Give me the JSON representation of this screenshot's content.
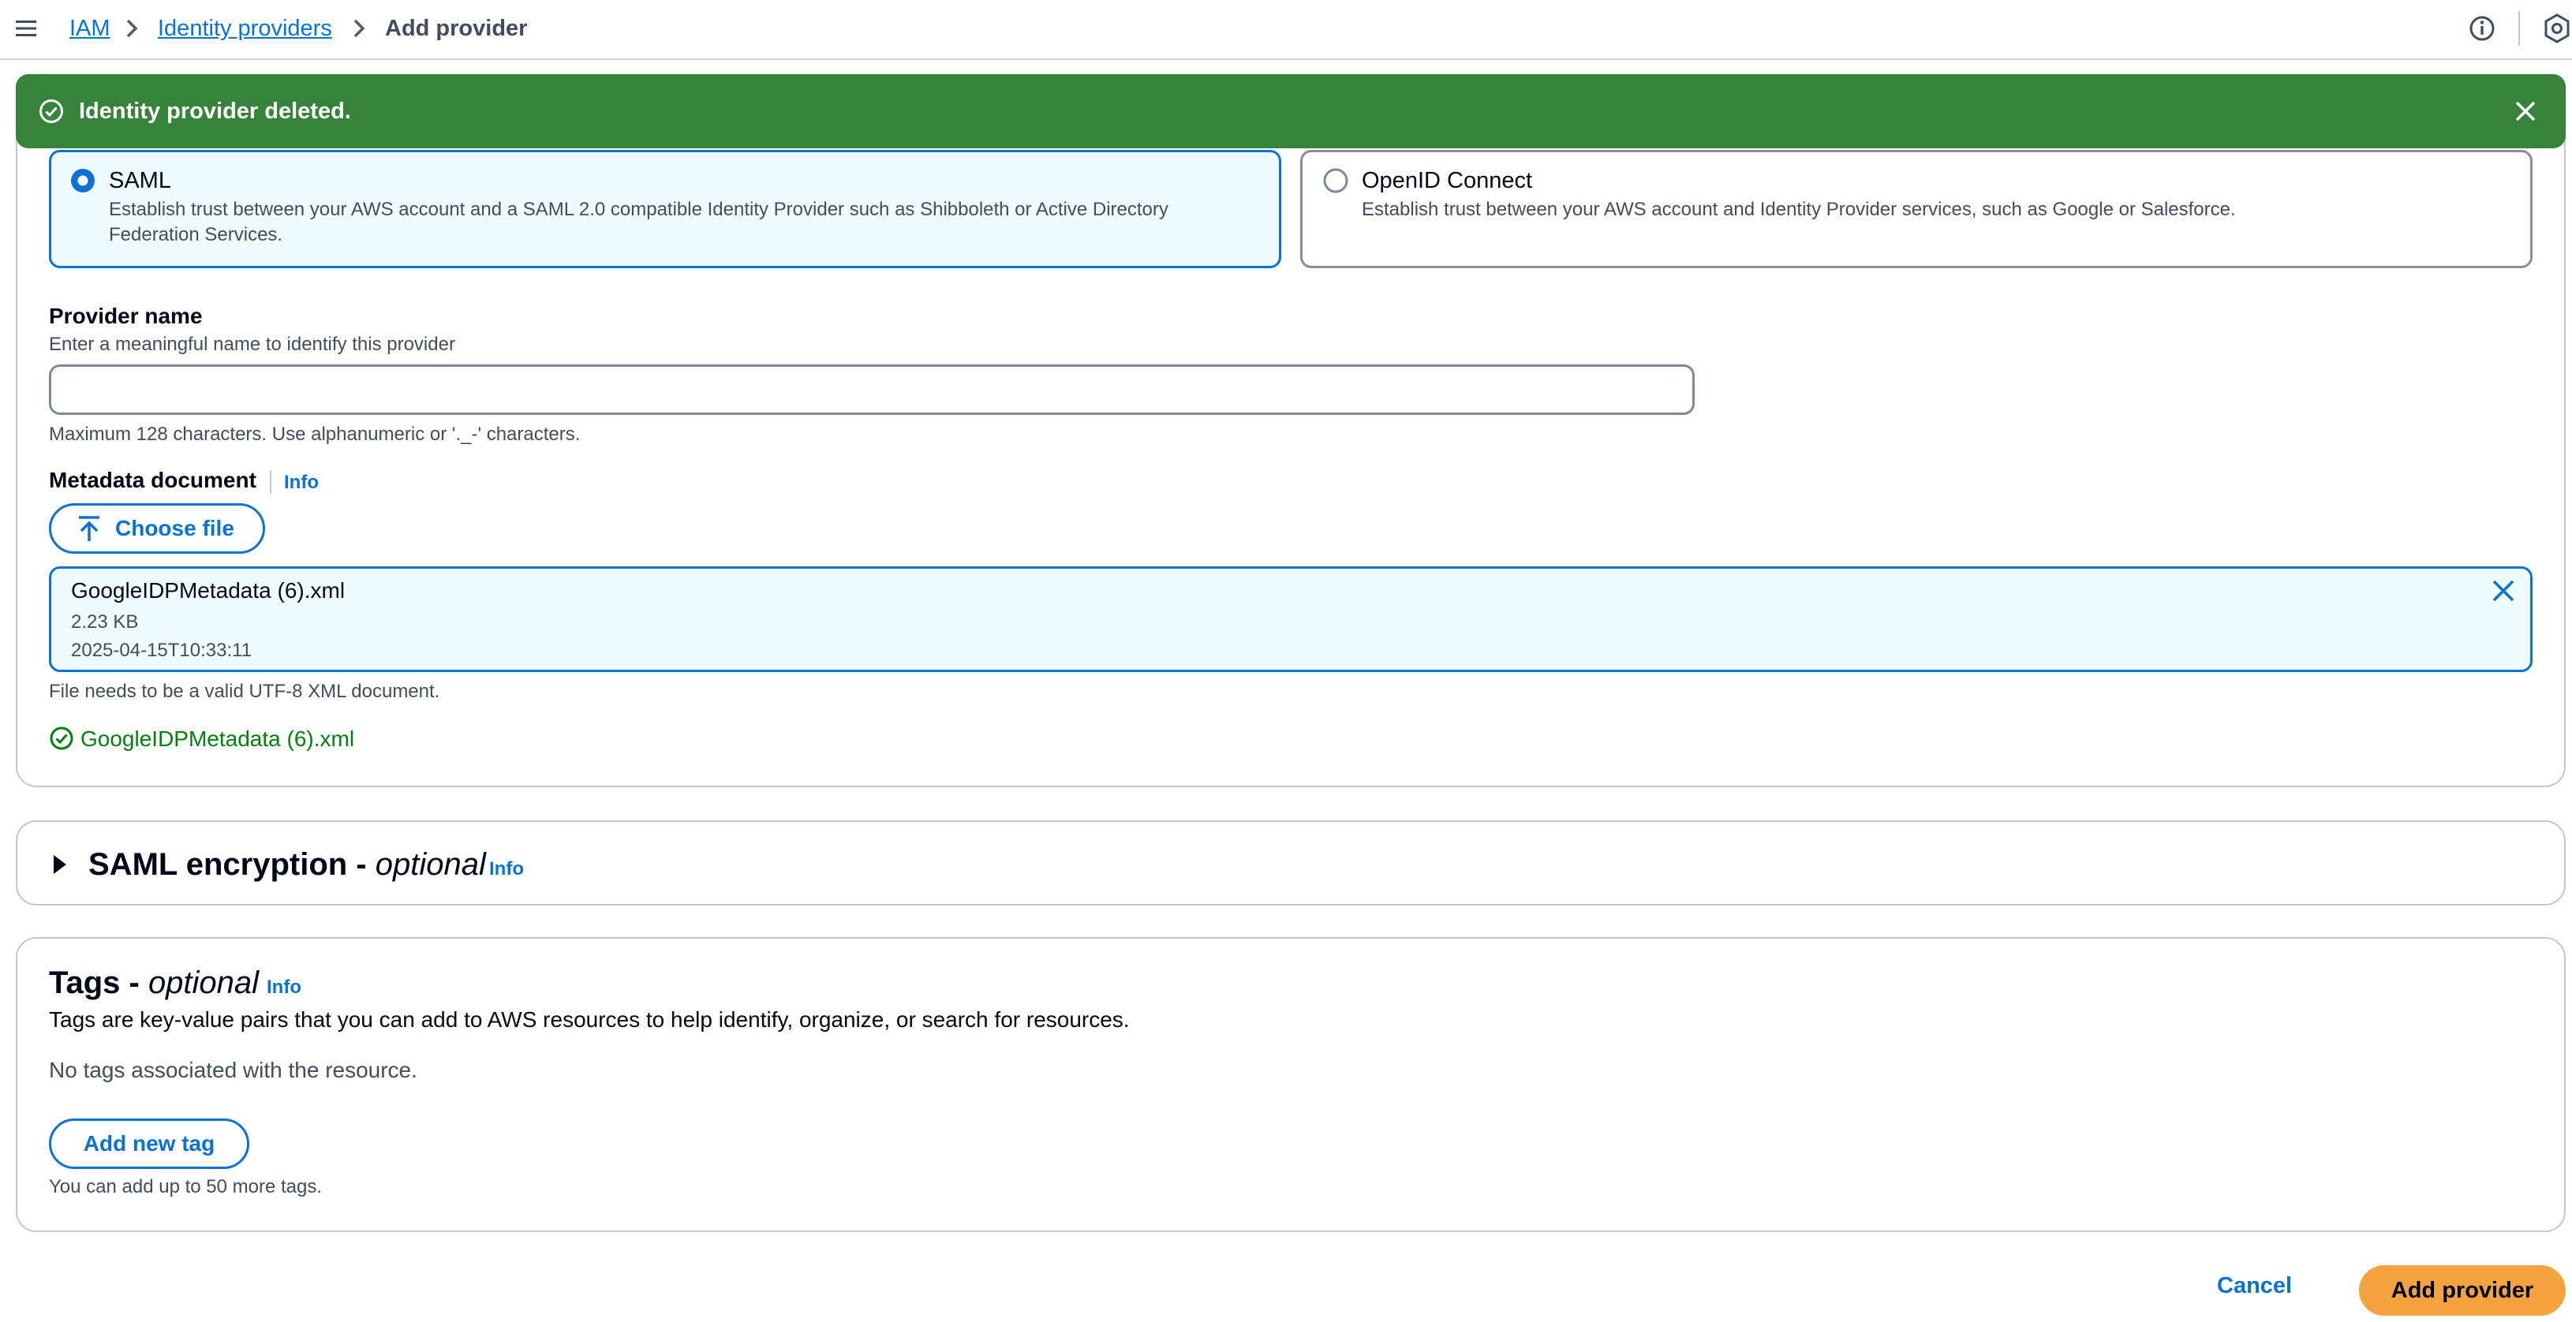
{
  "breadcrumb": {
    "items": [
      "IAM",
      "Identity providers"
    ],
    "current": "Add provider"
  },
  "flash": {
    "message": "Identity provider deleted.",
    "color": "#37833b"
  },
  "provider_type": {
    "options": [
      {
        "title": "SAML",
        "description": "Establish trust between your AWS account and a SAML 2.0 compatible Identity Provider such as Shibboleth or Active Directory Federation Services.",
        "selected": true
      },
      {
        "title": "OpenID Connect",
        "description": "Establish trust between your AWS account and Identity Provider services, such as Google or Salesforce.",
        "selected": false
      }
    ]
  },
  "provider_name": {
    "label": "Provider name",
    "description": "Enter a meaningful name to identify this provider",
    "value": "",
    "constraint": "Maximum 128 characters. Use alphanumeric or '._-' characters."
  },
  "metadata": {
    "label": "Metadata document",
    "info": "Info",
    "choose_file_label": "Choose file",
    "file": {
      "name": "GoogleIDPMetadata (6).xml",
      "size": "2.23 KB",
      "modified": "2025-04-15T10:33:11"
    },
    "constraint": "File needs to be a valid UTF-8 XML document.",
    "success_filename": "GoogleIDPMetadata (6).xml"
  },
  "saml_encryption": {
    "title": "SAML encryption - ",
    "title_optional": "optional",
    "info": "Info"
  },
  "tags": {
    "title": "Tags - ",
    "title_optional": "optional",
    "info": "Info",
    "description": "Tags are key-value pairs that you can add to AWS resources to help identify, organize, or search for resources.",
    "empty": "No tags associated with the resource.",
    "add_label": "Add new tag",
    "limit": "You can add up to 50 more tags."
  },
  "actions": {
    "cancel": "Cancel",
    "submit": "Add provider",
    "submit_color": "#f4a340"
  },
  "accent_color": "#0972d3"
}
